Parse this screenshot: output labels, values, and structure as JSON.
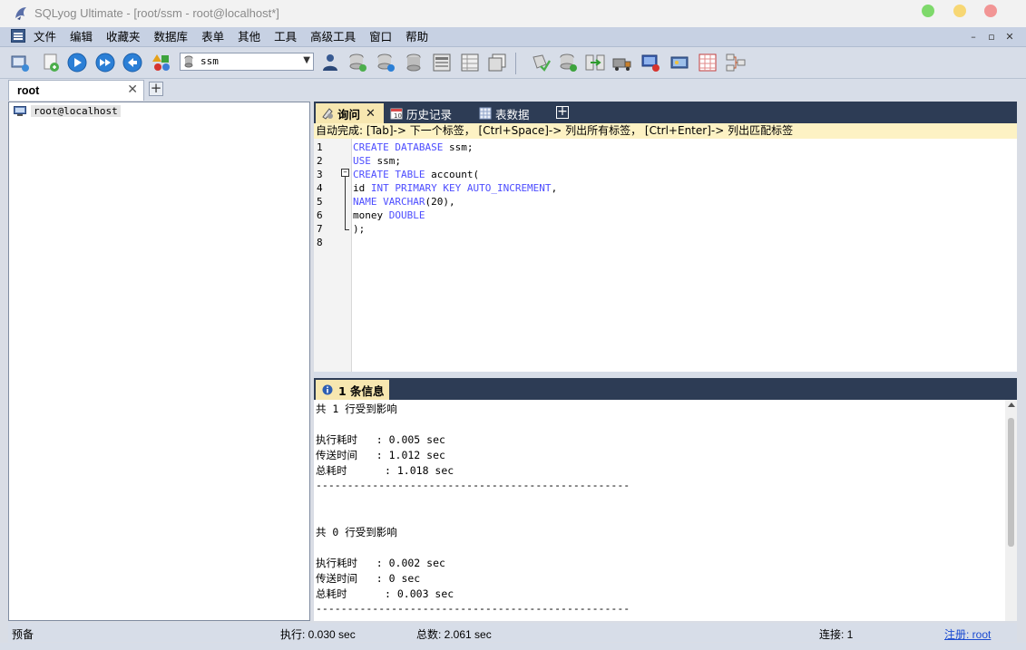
{
  "window": {
    "title": "SQLyog Ultimate - [root/ssm - root@localhost*]"
  },
  "menu": [
    "文件",
    "编辑",
    "收藏夹",
    "数据库",
    "表单",
    "其他",
    "工具",
    "高级工具",
    "窗口",
    "帮助"
  ],
  "mdi_controls": {
    "minimize": "–",
    "restore": "▫",
    "close": "✕"
  },
  "toolbar": {
    "database": "ssm"
  },
  "connection_tab": {
    "label": "root",
    "close": "✕",
    "add": "+"
  },
  "tree": {
    "root_label": "root@localhost"
  },
  "query_tabs": [
    {
      "label": "询问",
      "close": "✕"
    },
    {
      "label": "历史记录"
    },
    {
      "label": "表数据"
    }
  ],
  "query_tab_add": "+",
  "autocomplete_hint": "自动完成:  [Tab]-> 下一个标签， [Ctrl+Space]-> 列出所有标签， [Ctrl+Enter]-> 列出匹配标签",
  "editor": {
    "line_numbers": [
      "1",
      "2",
      "3",
      "4",
      "5",
      "6",
      "7",
      "8"
    ],
    "lines": [
      [
        {
          "t": "CREATE DATABASE",
          "k": true
        },
        {
          "t": " ssm;",
          "k": false
        }
      ],
      [
        {
          "t": "USE",
          "k": true
        },
        {
          "t": " ssm;",
          "k": false
        }
      ],
      [
        {
          "t": "CREATE TABLE",
          "k": true
        },
        {
          "t": " account(",
          "k": false
        }
      ],
      [
        {
          "t": "id ",
          "k": false
        },
        {
          "t": "INT PRIMARY KEY AUTO_INCREMENT",
          "k": true
        },
        {
          "t": ",",
          "k": false
        }
      ],
      [
        {
          "t": "NAME VARCHAR",
          "k": true
        },
        {
          "t": "(20),",
          "k": false
        }
      ],
      [
        {
          "t": "money ",
          "k": false
        },
        {
          "t": "DOUBLE",
          "k": true
        }
      ],
      [
        {
          "t": ");",
          "k": false
        }
      ],
      []
    ]
  },
  "messages": {
    "tab_label": "1 条信息",
    "lines": [
      "共 1 行受到影响",
      "",
      "执行耗时   : 0.005 sec",
      "传送时间   : 1.012 sec",
      "总耗时      : 1.018 sec",
      "--------------------------------------------------",
      "",
      "",
      "共 0 行受到影响",
      "",
      "执行耗时   : 0.002 sec",
      "传送时间   : 0 sec",
      "总耗时      : 0.003 sec",
      "--------------------------------------------------"
    ]
  },
  "status": {
    "ready": "预备",
    "exec": "执行: 0.030 sec",
    "total": "总数: 2.061 sec",
    "connections": "连接: 1",
    "register": "注册: root"
  },
  "colors": {
    "tab_strip": "#2d3c55",
    "active_tab": "#f7e7b0",
    "keyword": "#4d4dff",
    "autocomplete_bg": "#fdf2c4"
  }
}
